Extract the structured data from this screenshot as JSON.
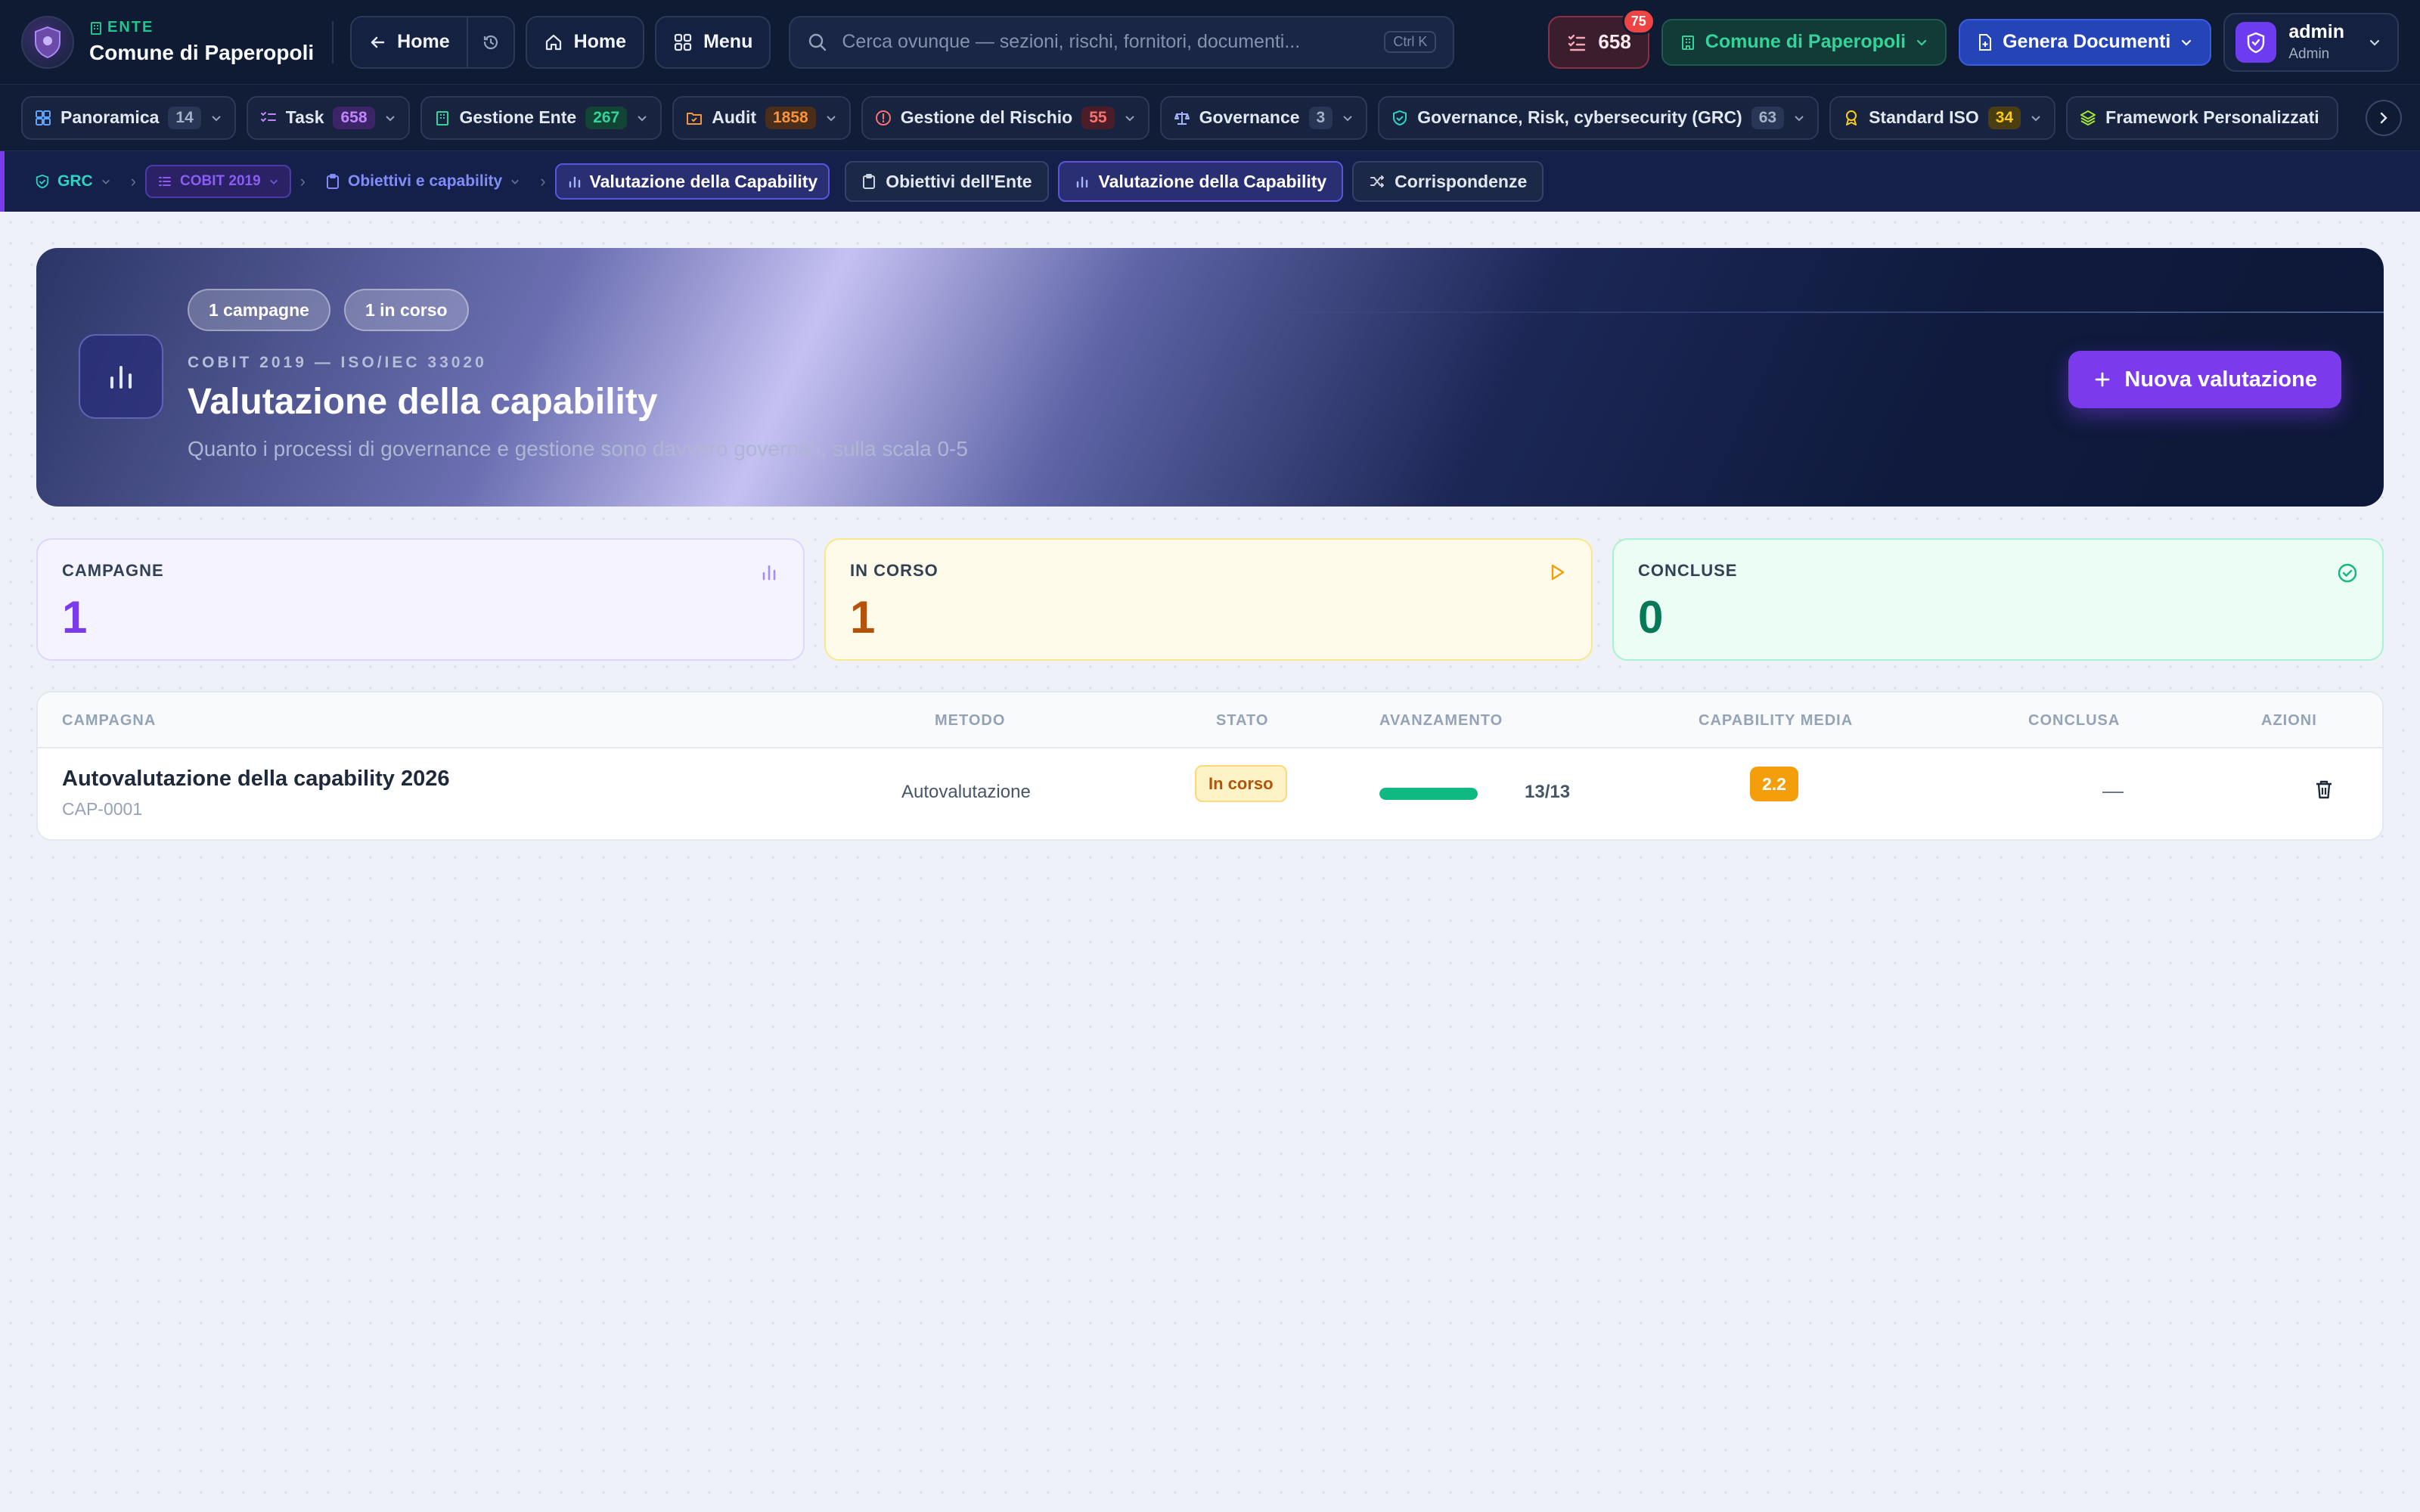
{
  "header": {
    "ente_kicker": "ENTE",
    "ente_name": "Comune di Paperopoli",
    "back_home_label": "Home",
    "home_label": "Home",
    "menu_label": "Menu",
    "search_placeholder": "Cerca ovunque — sezioni, rischi, fornitori, documenti...",
    "search_shortcut": "Ctrl K",
    "tasks_count": "658",
    "tasks_badge": "75",
    "org_selector": "Comune di Paperopoli",
    "generate_label": "Genera Documenti",
    "user_name": "admin",
    "user_role": "Admin"
  },
  "modules": [
    {
      "label": "Panoramica",
      "count": "14"
    },
    {
      "label": "Task",
      "count": "658"
    },
    {
      "label": "Gestione Ente",
      "count": "267"
    },
    {
      "label": "Audit",
      "count": "1858"
    },
    {
      "label": "Gestione del Rischio",
      "count": "55"
    },
    {
      "label": "Governance",
      "count": "3"
    },
    {
      "label": "Governance, Risk, cybersecurity (GRC)",
      "count": "63"
    },
    {
      "label": "Standard ISO",
      "count": "34"
    },
    {
      "label": "Framework Personalizzati",
      "count": ""
    }
  ],
  "breadcrumb": {
    "grc": "GRC",
    "cobit": "COBIT 2019",
    "objectives": "Obiettivi e capability",
    "current": "Valutazione della Capability"
  },
  "subtabs": [
    {
      "label": "Obiettivi dell'Ente"
    },
    {
      "label": "Valutazione della Capability"
    },
    {
      "label": "Corrispondenze"
    }
  ],
  "hero": {
    "pill_campaigns": "1 campagne",
    "pill_in_progress": "1 in corso",
    "kicker": "COBIT 2019 — ISO/IEC 33020",
    "title": "Valutazione della capability",
    "subtitle": "Quanto i processi di governance e gestione sono davvero governati, sulla scala 0-5",
    "cta": "Nuova valutazione"
  },
  "stats": {
    "campaigns": {
      "label": "CAMPAGNE",
      "value": "1"
    },
    "in_progress": {
      "label": "IN CORSO",
      "value": "1"
    },
    "completed": {
      "label": "CONCLUSE",
      "value": "0"
    }
  },
  "table": {
    "columns": {
      "campaign": "CAMPAGNA",
      "method": "METODO",
      "status": "STATO",
      "progress": "AVANZAMENTO",
      "capability": "CAPABILITY MEDIA",
      "completed": "CONCLUSA",
      "actions": "AZIONI"
    },
    "rows": [
      {
        "name": "Autovalutazione della capability 2026",
        "code": "CAP-0001",
        "method": "Autovalutazione",
        "status": "In corso",
        "progress_label": "13/13",
        "progress_fraction": 1.0,
        "capability": "2.2",
        "completed": "—"
      }
    ]
  },
  "colors": {
    "accent": "#7c3aed",
    "status_in_progress": "#b45309",
    "progress": "#10b981",
    "capability_badge": "#f59e0b"
  }
}
